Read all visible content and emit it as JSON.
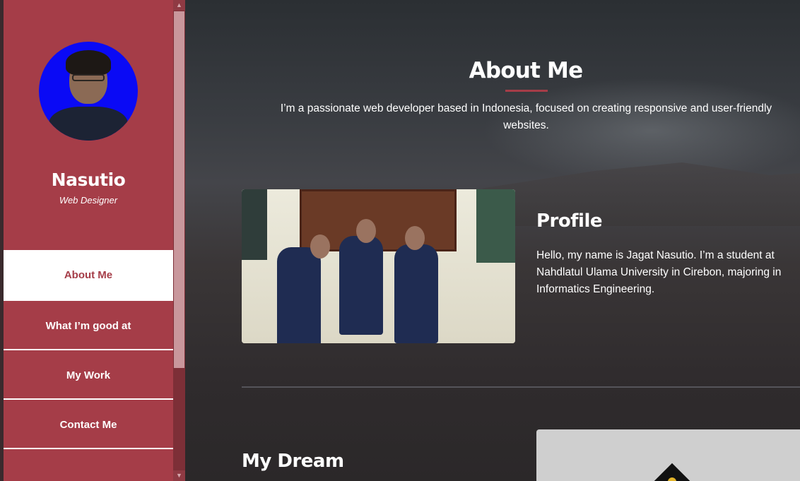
{
  "sidebar": {
    "name": "Nasutio",
    "role": "Web Designer",
    "nav": [
      {
        "label": "About Me",
        "active": true
      },
      {
        "label": "What I’m good at",
        "active": false
      },
      {
        "label": "My Work",
        "active": false
      },
      {
        "label": "Contact Me",
        "active": false
      }
    ],
    "accent_color": "#a53d48"
  },
  "scrollbar": {
    "up_icon": "chevron-up-icon",
    "down_icon": "chevron-down-icon"
  },
  "main": {
    "title": "About Me",
    "intro": "I’m a passionate web developer based in Indonesia, focused on creating responsive and user-friendly websites.",
    "profile": {
      "heading": "Profile",
      "text": "Hello, my name is Jagat Nasutio. I’m a student at Nahdlatul Ulama University in Cirebon, majoring in Informatics Engineering."
    },
    "dream": {
      "heading": "My Dream"
    }
  }
}
